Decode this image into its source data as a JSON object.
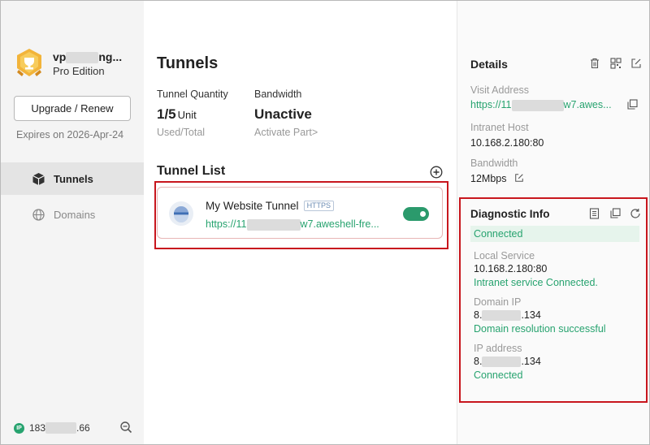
{
  "window": {
    "menu_icon": "menu-icon",
    "minimize_icon": "minimize-icon",
    "close_icon": "close-icon"
  },
  "sidebar": {
    "user_name_prefix": "vp",
    "user_name_suffix": "ng...",
    "edition": "Pro Edition",
    "upgrade_label": "Upgrade / Renew",
    "expires": "Expires on 2026-Apr-24",
    "nav": [
      {
        "label": "Tunnels",
        "icon": "cube-icon",
        "active": true
      },
      {
        "label": "Domains",
        "icon": "globe-icon",
        "active": false
      }
    ],
    "ip_badge": "IP",
    "ip_prefix": "183",
    "ip_suffix": ".66"
  },
  "main": {
    "title": "Tunnels",
    "stats": {
      "quantity_label": "Tunnel Quantity",
      "quantity_value": "1/5",
      "quantity_unit": "Unit",
      "quantity_sub": "Used/Total",
      "bandwidth_label": "Bandwidth",
      "bandwidth_value": "Unactive",
      "bandwidth_sub": "Activate Part>"
    },
    "list_title": "Tunnel List",
    "tunnels": [
      {
        "name": "My Website Tunnel",
        "protocol": "HTTPS",
        "url_prefix": "https://11",
        "url_suffix": "w7.aweshell-fre...",
        "enabled": true
      }
    ]
  },
  "details": {
    "title": "Details",
    "visit_address_label": "Visit Address",
    "visit_address_prefix": "https://11",
    "visit_address_suffix": "w7.awes...",
    "intranet_host_label": "Intranet Host",
    "intranet_host": "10.168.2.180:80",
    "bandwidth_label": "Bandwidth",
    "bandwidth": "12Mbps"
  },
  "diagnostic": {
    "title": "Diagnostic Info",
    "status": "Connected",
    "local_service_label": "Local Service",
    "local_service": "10.168.2.180:80",
    "local_service_status": "Intranet service Connected.",
    "domain_ip_label": "Domain IP",
    "domain_ip_prefix": "8.",
    "domain_ip_suffix": ".134",
    "domain_ip_status": "Domain resolution successful",
    "ip_address_label": "IP address",
    "ip_address_prefix": "8.",
    "ip_address_suffix": ".134",
    "ip_address_status": "Connected"
  },
  "colors": {
    "accent_green": "#27a36f",
    "highlight_red": "#c8161d",
    "sidebar_bg": "#f4f4f4"
  }
}
